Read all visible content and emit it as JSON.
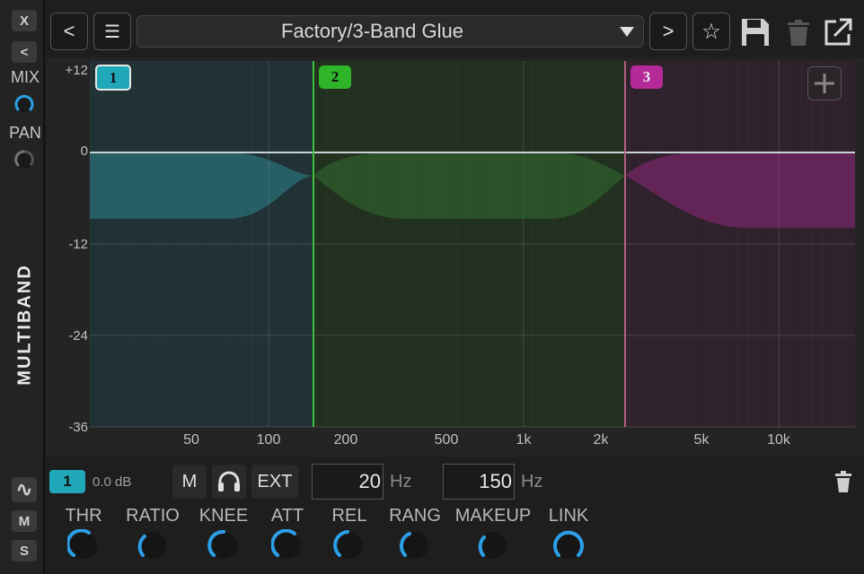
{
  "sidebar": {
    "close_label": "X",
    "collapse_label": "<",
    "mix_label": "MIX",
    "pan_label": "PAN",
    "title": "MULTIBAND",
    "wave_label": "∿",
    "m_label": "M",
    "s_label": "S"
  },
  "toolbar": {
    "prev_label": "<",
    "menu_label": "☰",
    "preset_name": "Factory/3-Band Glue",
    "next_label": ">",
    "favorite_label": "☆"
  },
  "graph": {
    "y_labels": [
      "+12",
      "0",
      "-12",
      "-24",
      "-36"
    ],
    "x_labels": [
      "50",
      "100",
      "200",
      "500",
      "1k",
      "2k",
      "5k",
      "10k"
    ],
    "bands": [
      {
        "label": "1",
        "color": "#21a8b8"
      },
      {
        "label": "2",
        "color": "#2fb52a"
      },
      {
        "label": "3",
        "color": "#b52a98"
      }
    ],
    "crossovers_hz": [
      150,
      2500
    ]
  },
  "band_controls": {
    "selected_band": "1",
    "gain": "0.0 dB",
    "mute_label": "M",
    "ext_label": "EXT",
    "low_freq": "20",
    "high_freq": "150",
    "unit": "Hz"
  },
  "knobs": [
    {
      "label": "THR"
    },
    {
      "label": "RATIO"
    },
    {
      "label": "KNEE"
    },
    {
      "label": "ATT"
    },
    {
      "label": "REL"
    },
    {
      "label": "RANG"
    },
    {
      "label": "MAKEUP"
    },
    {
      "label": "LINK"
    }
  ],
  "colors": {
    "accent": "#2b9fe8",
    "band1": "#21a8b8",
    "band2": "#2fb52a",
    "band3": "#b52a98"
  }
}
